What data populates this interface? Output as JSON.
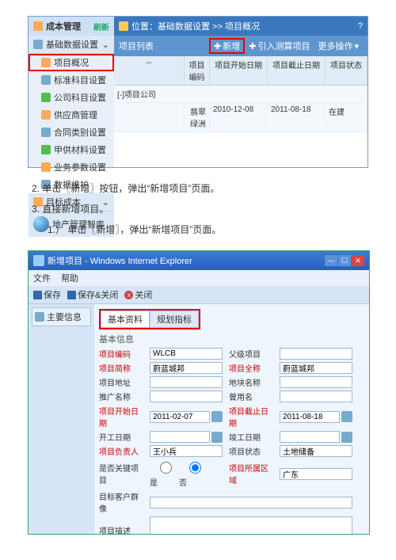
{
  "shot1": {
    "title": "成本管理",
    "refresh": "刷新",
    "sec_base": "基础数据设置",
    "items": [
      "项目概况",
      "标准科目设置",
      "公司科目设置",
      "供应商管理",
      "合同类别设置",
      "甲供材料设置",
      "业务参数设置",
      "数据维护"
    ],
    "sec_target": "目标成本",
    "lib": "地产管理智库",
    "breadcrumb": "位置：基础数据设置 >> 项目概况",
    "list_title": "项目列表",
    "btn_new": "新增",
    "btn_import": "引入测算项目",
    "btn_more": "更多操作",
    "cols": [
      "--",
      "项目编码",
      "项目开始日期",
      "项目截止日期",
      "项目状态"
    ],
    "group": "[-]项目公司",
    "row": {
      "name": "翡翠绿洲",
      "start": "2010-12-08",
      "end": "2011-08-18",
      "status": "在建"
    }
  },
  "instr": {
    "s2": "2.  单击〖新增〗按钮，弹出“新增项目”页面。",
    "s3": "3.  直接新增项目。",
    "s3_1": "1.） 单击〖新增〗，弹出“新增项目”页面。"
  },
  "shot2": {
    "win_title": "新增项目 - Windows Internet Explorer",
    "menu": [
      "文件",
      "帮助"
    ],
    "tb": {
      "save": "保存",
      "save_close": "保存&关闭",
      "close": "关闭"
    },
    "nav": "主要信息",
    "tabs": [
      "基本资料",
      "规划指标"
    ],
    "fs": "基本信息",
    "f": {
      "code_l": "项目编码",
      "code_v": "WLCB",
      "parent_l": "父级项目",
      "parent_v": "",
      "name_l": "项目简称",
      "name_v": "蔚蓝城邦",
      "fname_l": "项目全称",
      "fname_v": "蔚蓝城邦",
      "addr_l": "项目地址",
      "plot_l": "地块名称",
      "promo_l": "推广名称",
      "alias_l": "曾用名",
      "start_l": "项目开始日期",
      "start_v": "2011-02-07",
      "end_l": "项目截止日期",
      "end_v": "2011-08-18",
      "bstart_l": "开工日期",
      "bend_l": "竣工日期",
      "owner_l": "项目负责人",
      "owner_v": "王小兵",
      "status_l": "项目状态",
      "status_v": "土地储备",
      "key_l": "是否关键项目",
      "key_y": "是",
      "key_n": "否",
      "region_l": "项目所属区域",
      "region_v": "广东",
      "cust_l": "目标客户群像",
      "desc_l": "项目描述"
    }
  }
}
